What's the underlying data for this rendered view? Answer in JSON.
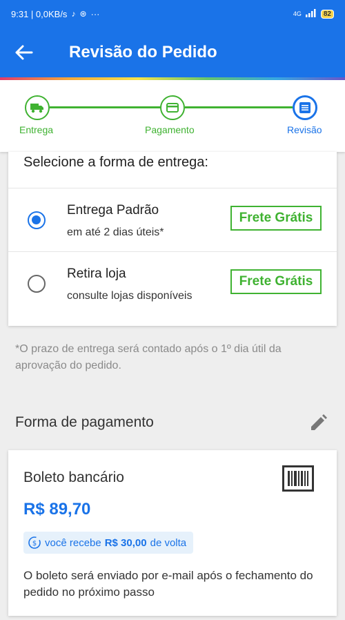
{
  "status_bar": {
    "time_speed": "9:31 | 0,0KB/s",
    "dots": "···",
    "network": "4G",
    "battery": "82"
  },
  "app_bar": {
    "title": "Revisão do Pedido"
  },
  "stepper": {
    "steps": [
      {
        "label": "Entrega",
        "icon": "truck-icon",
        "state": "completed"
      },
      {
        "label": "Pagamento",
        "icon": "card-icon",
        "state": "completed"
      },
      {
        "label": "Revisão",
        "icon": "list-icon",
        "state": "active"
      }
    ],
    "colors": {
      "completed": "#3fb231",
      "active": "#1a73e8"
    }
  },
  "delivery": {
    "heading": "Selecione a forma de entrega:",
    "options": [
      {
        "title": "Entrega Padrão",
        "subtitle": "em até 2 dias úteis*",
        "badge": "Frete Grátis",
        "selected": true
      },
      {
        "title": "Retira loja",
        "subtitle": "consulte lojas disponíveis",
        "badge": "Frete Grátis",
        "selected": false
      }
    ],
    "note": "*O prazo de entrega será contado após o 1º dia útil da aprovação do pedido."
  },
  "payment": {
    "section_title": "Forma de pagamento",
    "method": "Boleto bancário",
    "price": "R$ 89,70",
    "cashback": {
      "prefix": "você recebe",
      "amount": "R$ 30,00",
      "suffix": "de volta"
    },
    "note": "O boleto será enviado por e-mail após o fechamento do pedido no próximo passo"
  },
  "colors": {
    "primary": "#1a73e8",
    "success": "#3fb231"
  }
}
